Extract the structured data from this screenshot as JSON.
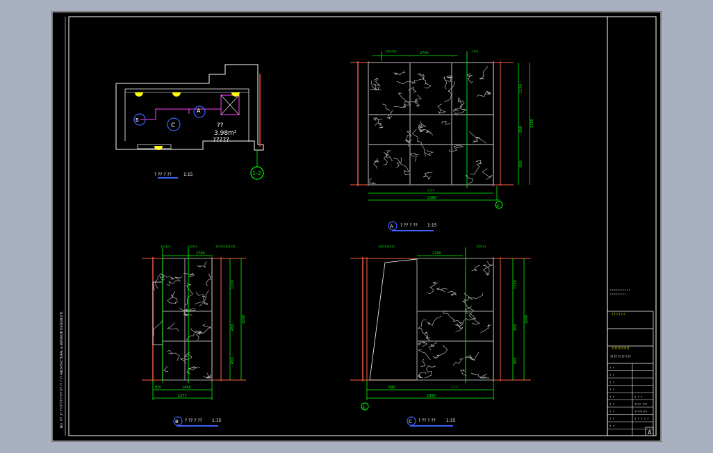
{
  "plan": {
    "room_code": "??",
    "area": "3.98m²",
    "room_sub": "?????",
    "marker_a": "A",
    "marker_b": "B",
    "marker_c": "C",
    "axis_label": "1-2",
    "title_scale": "1:15"
  },
  "elev_a": {
    "tag": "A",
    "scale": "1:15",
    "top_note_left": "???????",
    "top_note_right": "????",
    "dim_green": "2700",
    "dim_total": "2360",
    "dim_h1": "1150",
    "dim_h2": "550",
    "dim_h3": "550",
    "dim_right": "2700",
    "axis_label": "①"
  },
  "elev_b": {
    "tag": "B",
    "scale": "1:15",
    "top_note_1": "??????",
    "top_note_2": "??????",
    "top_note_3": "????????????",
    "dim_green": "2700",
    "dim_left": "300",
    "dim_mid": "1450",
    "dim_total": "1277",
    "dim_h1": "1150",
    "dim_h2": "450",
    "dim_h3": "450",
    "dim_right": "2000"
  },
  "elev_c": {
    "tag": "C",
    "scale": "1:15",
    "top_note_1": "??????????",
    "top_note_2": "??????",
    "dim_green": "2700",
    "dim_left": "690",
    "dim_total": "2360",
    "dim_h1": "1150",
    "dim_h2": "450",
    "dim_h3": "450",
    "dim_right": "2000",
    "axis_label": "①"
  },
  "side_strip": {
    "text": "NO. ??? 2? ??????????????? ?? ? ?? ARCHITECTURAL & INTERIOR DESIGN LTD."
  },
  "title_block": {
    "notes": [
      "? ? ? ? ? ? ? ? ? ?",
      "? ? ? ? ? ? ? ?"
    ],
    "project_line": "? ? ? ? ? ?",
    "stamp_line": "????????????",
    "drawing_name": "?? ?? ?? ??  ? ??",
    "rows": [
      {
        "label": "? ?",
        "value": ""
      },
      {
        "label": "? ?",
        "value": ""
      },
      {
        "label": "? ?",
        "value": ""
      },
      {
        "label": "? ?",
        "value": ""
      },
      {
        "label": "? ?",
        "value": "? ? ?"
      },
      {
        "label": "? ?",
        "value": "???? ???"
      },
      {
        "label": "? ?",
        "value": "????????"
      },
      {
        "label": "? ?",
        "value": "? ? ? ? ?"
      },
      {
        "label": "? ?",
        "value": ""
      }
    ],
    "sheet_letter": "A"
  }
}
